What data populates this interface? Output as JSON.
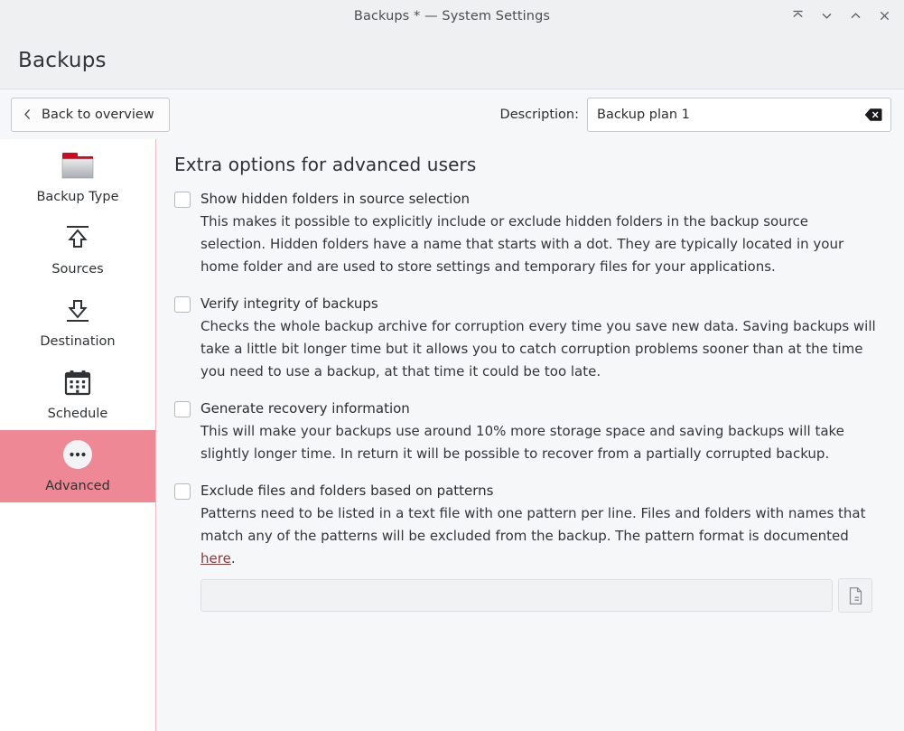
{
  "window": {
    "title": "Backups * — System Settings",
    "controls": [
      {
        "name": "keep-above-icon",
        "label": "Keep above"
      },
      {
        "name": "minimize-icon",
        "label": "Minimize"
      },
      {
        "name": "maximize-icon",
        "label": "Maximize"
      },
      {
        "name": "close-icon",
        "label": "Close"
      }
    ]
  },
  "header": {
    "title": "Backups"
  },
  "toolbar": {
    "back_label": "Back to overview",
    "description_label": "Description:",
    "description_value": "Backup plan 1",
    "description_placeholder": "",
    "clear_icon": "clear-text-icon"
  },
  "sidebar": {
    "items": [
      {
        "label": "Backup Type",
        "icon": "folder-icon",
        "active": false
      },
      {
        "label": "Sources",
        "icon": "upload-icon",
        "active": false
      },
      {
        "label": "Destination",
        "icon": "download-icon",
        "active": false
      },
      {
        "label": "Schedule",
        "icon": "calendar-icon",
        "active": false
      },
      {
        "label": "Advanced",
        "icon": "more-options-icon",
        "active": true
      }
    ]
  },
  "main": {
    "heading": "Extra options for advanced users",
    "options": [
      {
        "title": "Show hidden folders in source selection",
        "checked": false,
        "description": "This makes it possible to explicitly include or exclude hidden folders in the backup source selection. Hidden folders have a name that starts with a dot. They are typically located in your home folder and are used to store settings and temporary files for your applications."
      },
      {
        "title": "Verify integrity of backups",
        "checked": false,
        "description": "Checks the whole backup archive for corruption every time you save new data. Saving backups will take a little bit longer time but it allows you to catch corruption problems sooner than at the time you need to use a backup, at that time it could be too late."
      },
      {
        "title": "Generate recovery information",
        "checked": false,
        "description": "This will make your backups use around 10% more storage space and saving backups will take slightly longer time. In return it will be possible to recover from a partially corrupted backup."
      },
      {
        "title": "Exclude files and folders based on patterns",
        "checked": false,
        "description_before_link": "Patterns need to be listed in a text file with one pattern per line. Files and folders with names that match any of the patterns will be excluded from the backup. The pattern format is documented ",
        "link_text": "here",
        "description_after_link": ".",
        "pattern_file_value": "",
        "pattern_file_placeholder": "",
        "browse_icon": "file-document-icon"
      }
    ]
  },
  "colors": {
    "accent": "#ed8894",
    "divider": "#f0b8bf",
    "link": "#8a3b3b",
    "header_bg": "#eff0f1",
    "content_bg": "#f6f7f8"
  }
}
